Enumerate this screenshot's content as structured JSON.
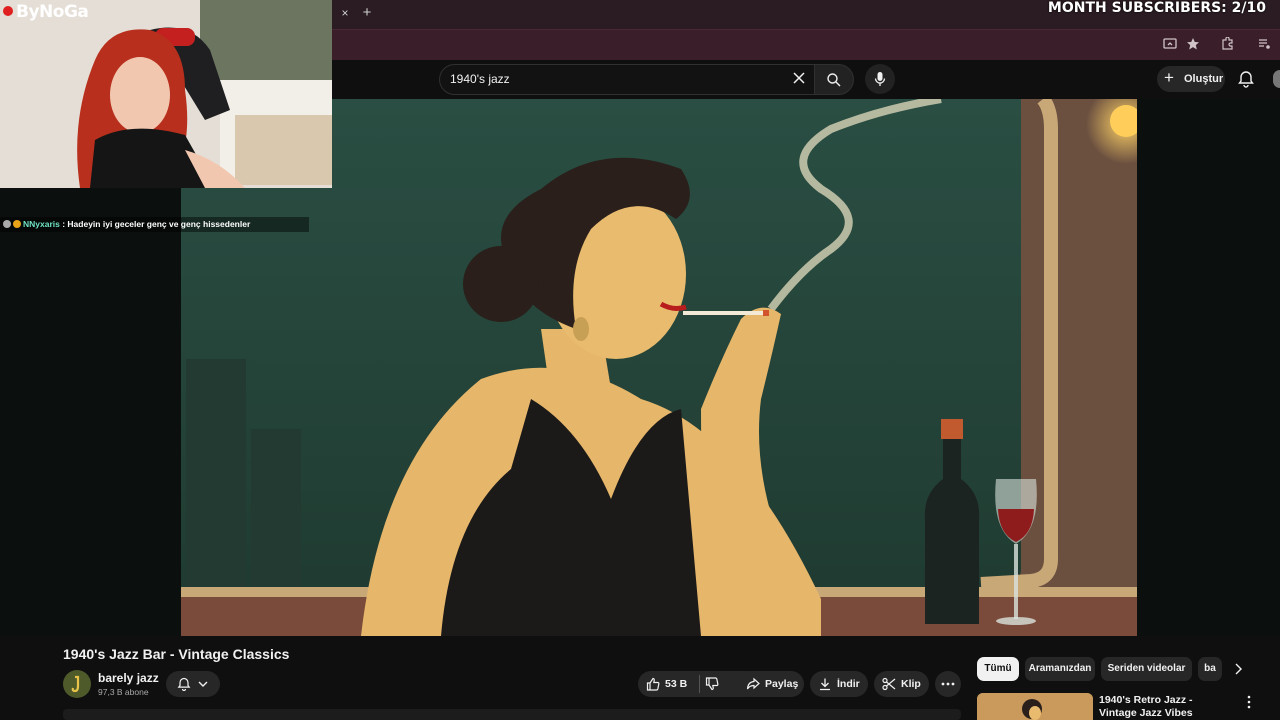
{
  "overlay": {
    "brand": "ByNoGa",
    "month_subscribers": "MONTH SUBSCRIBERS: 2/10"
  },
  "chat": {
    "username": "NNyxaris",
    "separator": " : ",
    "message": "Hadeyin iyi geceler genç ve genç hissedenler"
  },
  "browser": {
    "tab_close": "×",
    "new_tab": "+"
  },
  "header": {
    "search_query": "1940's jazz",
    "create_label": "Oluştur"
  },
  "video": {
    "title": "1940's Jazz Bar - Vintage Classics",
    "channel_name": "barely jazz",
    "channel_subs": "97,3 B abone",
    "like_count": "53 B",
    "share_label": "Paylaş",
    "download_label": "İndir",
    "clip_label": "Klip"
  },
  "chips": {
    "items": [
      "Tümü",
      "Aramanızdan",
      "Seriden videolar",
      "ba"
    ]
  },
  "recommendation": {
    "title": "1940's Retro Jazz - Vintage Jazz Vibes"
  },
  "colors": {
    "accent": "#e02020",
    "chat_user": "#6fe3c3",
    "youtube_bg": "#0f0f0f"
  }
}
